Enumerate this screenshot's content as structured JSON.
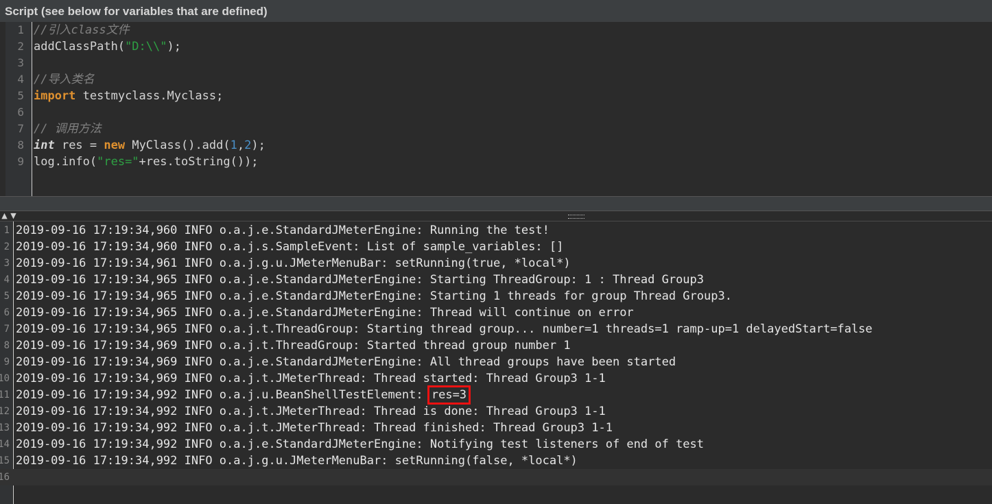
{
  "panel_title": "Script (see below for variables that are defined)",
  "script_lines": [
    {
      "n": "1",
      "tokens": [
        {
          "t": "//引入class文件",
          "c": "comment"
        }
      ]
    },
    {
      "n": "2",
      "tokens": [
        {
          "t": "addClassPath(",
          "c": "plain"
        },
        {
          "t": "\"D:\\\\\"",
          "c": "string"
        },
        {
          "t": ");",
          "c": "plain"
        }
      ]
    },
    {
      "n": "3",
      "tokens": []
    },
    {
      "n": "4",
      "tokens": [
        {
          "t": "//导入类名",
          "c": "comment"
        }
      ]
    },
    {
      "n": "5",
      "tokens": [
        {
          "t": "import",
          "c": "keyword"
        },
        {
          "t": " testmyclass.Myclass;",
          "c": "plain"
        }
      ]
    },
    {
      "n": "6",
      "tokens": []
    },
    {
      "n": "7",
      "tokens": [
        {
          "t": "// 调用方法",
          "c": "comment"
        }
      ]
    },
    {
      "n": "8",
      "tokens": [
        {
          "t": "int",
          "c": "type"
        },
        {
          "t": " res = ",
          "c": "plain"
        },
        {
          "t": "new",
          "c": "keyword"
        },
        {
          "t": " MyClass().add(",
          "c": "plain"
        },
        {
          "t": "1",
          "c": "number"
        },
        {
          "t": ",",
          "c": "plain"
        },
        {
          "t": "2",
          "c": "number"
        },
        {
          "t": ");",
          "c": "plain"
        }
      ]
    },
    {
      "n": "9",
      "tokens": [
        {
          "t": "log.info(",
          "c": "plain"
        },
        {
          "t": "\"res=\"",
          "c": "string"
        },
        {
          "t": "+res.toString());",
          "c": "plain"
        }
      ]
    }
  ],
  "splitter": {
    "collapse_up_icon": "triangle-up",
    "collapse_down_icon": "triangle-down"
  },
  "log_lines": [
    {
      "n": "1",
      "text": "2019-09-16 17:19:34,960 INFO o.a.j.e.StandardJMeterEngine: Running the test!"
    },
    {
      "n": "2",
      "text": "2019-09-16 17:19:34,960 INFO o.a.j.s.SampleEvent: List of sample_variables: []"
    },
    {
      "n": "3",
      "text": "2019-09-16 17:19:34,961 INFO o.a.j.g.u.JMeterMenuBar: setRunning(true, *local*)"
    },
    {
      "n": "4",
      "text": "2019-09-16 17:19:34,965 INFO o.a.j.e.StandardJMeterEngine: Starting ThreadGroup: 1 : Thread Group3"
    },
    {
      "n": "5",
      "text": "2019-09-16 17:19:34,965 INFO o.a.j.e.StandardJMeterEngine: Starting 1 threads for group Thread Group3."
    },
    {
      "n": "6",
      "text": "2019-09-16 17:19:34,965 INFO o.a.j.e.StandardJMeterEngine: Thread will continue on error"
    },
    {
      "n": "7",
      "text": "2019-09-16 17:19:34,965 INFO o.a.j.t.ThreadGroup: Starting thread group... number=1 threads=1 ramp-up=1 delayedStart=false"
    },
    {
      "n": "8",
      "text": "2019-09-16 17:19:34,969 INFO o.a.j.t.ThreadGroup: Started thread group number 1"
    },
    {
      "n": "9",
      "text": "2019-09-16 17:19:34,969 INFO o.a.j.e.StandardJMeterEngine: All thread groups have been started"
    },
    {
      "n": "10",
      "text": "2019-09-16 17:19:34,969 INFO o.a.j.t.JMeterThread: Thread started: Thread Group3 1-1"
    },
    {
      "n": "11",
      "text": "2019-09-16 17:19:34,992 INFO o.a.j.u.BeanShellTestElement: ",
      "highlight": "res=3"
    },
    {
      "n": "12",
      "text": "2019-09-16 17:19:34,992 INFO o.a.j.t.JMeterThread: Thread is done: Thread Group3 1-1"
    },
    {
      "n": "13",
      "text": "2019-09-16 17:19:34,992 INFO o.a.j.t.JMeterThread: Thread finished: Thread Group3 1-1"
    },
    {
      "n": "14",
      "text": "2019-09-16 17:19:34,992 INFO o.a.j.e.StandardJMeterEngine: Notifying test listeners of end of test"
    },
    {
      "n": "15",
      "text": "2019-09-16 17:19:34,992 INFO o.a.j.g.u.JMeterMenuBar: setRunning(false, *local*)"
    },
    {
      "n": "16",
      "text": ""
    }
  ],
  "colors": {
    "background": "#2b2b2b",
    "comment": "#808080",
    "string": "#2ea043",
    "keyword": "#e0912f",
    "number": "#4a90c8",
    "highlight_box": "#ee1111"
  }
}
